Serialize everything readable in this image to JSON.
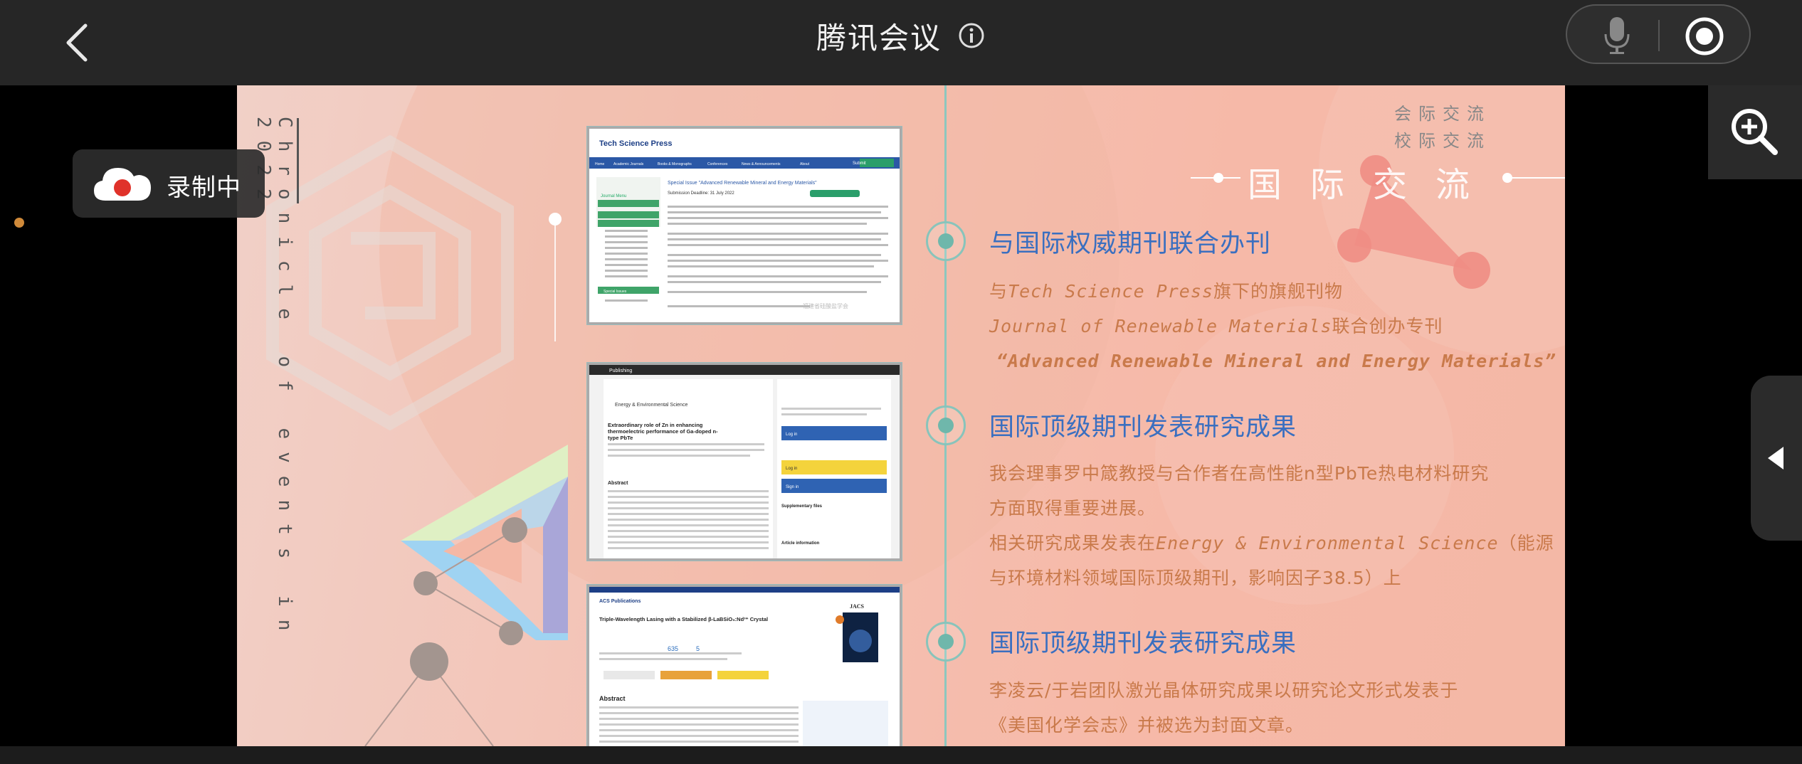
{
  "app": {
    "title": "腾讯会议"
  },
  "recording": {
    "label": "录制中"
  },
  "slide": {
    "chronicle": "Chronicle of events in 2022",
    "tags": [
      "会际交流",
      "校际交流"
    ],
    "banner": "国际交流",
    "sections": [
      {
        "title": "与国际权威期刊联合办刊",
        "lines": [
          {
            "pre": "与",
            "em": "Tech Science Press",
            "post": "旗下的旗舰刊物"
          },
          {
            "pre": "",
            "em": "Journal of Renewable Materials",
            "post": "联合创办专刊"
          },
          {
            "pre": "",
            "em": "“Advanced Renewable Mineral and Energy Materials”",
            "post": ""
          }
        ]
      },
      {
        "title": "国际顶级期刊发表研究成果",
        "lines": [
          {
            "pre": "我会理事罗中箴教授与合作者在高性能n型PbTe热电材料研究",
            "em": "",
            "post": ""
          },
          {
            "pre": "方面取得重要进展。",
            "em": "",
            "post": ""
          },
          {
            "pre": "相关研究成果发表在",
            "em": "Energy & Environmental Science",
            "post": "（能源"
          },
          {
            "pre": "与环境材料领域国际顶级期刊，影响因子38.5）上",
            "em": "",
            "post": ""
          }
        ]
      },
      {
        "title": "国际顶级期刊发表研究成果",
        "lines": [
          {
            "pre": "李凌云/于岩团队激光晶体研究成果以研究论文形式发表于",
            "em": "",
            "post": ""
          },
          {
            "pre": "《美国化学会志》并被选为封面文章。",
            "em": "",
            "post": ""
          }
        ]
      }
    ],
    "screenshots": [
      {
        "brand": "Tech Science Press",
        "nav": [
          "Home",
          "Academic Journals",
          "Books & Monographs",
          "Conferences",
          "News & Announcements",
          "About",
          "Submit"
        ],
        "heading": "Special Issue \"Advanced Renewable Mineral and Energy Materials\"",
        "deadline": "Submission Deadline: 31 July 2022",
        "menu": [
          "Journal Menu",
          "Special Issues"
        ],
        "watermark": "福建省硅酸盐学会"
      },
      {
        "brand": "Publishing",
        "journal": "Energy & Environmental Science",
        "heading": "Extraordinary role of Zn in enhancing thermoelectric performance of Ga-doped n-type PbTe",
        "section": "Abstract",
        "buttons": [
          "Log in",
          "Log in",
          "Sign in"
        ],
        "side_headings": [
          "Supplementary files",
          "Article information"
        ]
      },
      {
        "brand": "ACS Publications",
        "journal": "JACS",
        "heading": "Triple-Wavelength Lasing with a Stabilized β-LaBSiO₅:Nd³⁺ Crystal",
        "section": "Abstract",
        "metrics": [
          "635",
          "5"
        ]
      }
    ]
  },
  "colors": {
    "section_title": "#3a6fc0",
    "body_text": "#c97a4b",
    "timeline": "#6fb7ab",
    "topbar": "#262626"
  }
}
